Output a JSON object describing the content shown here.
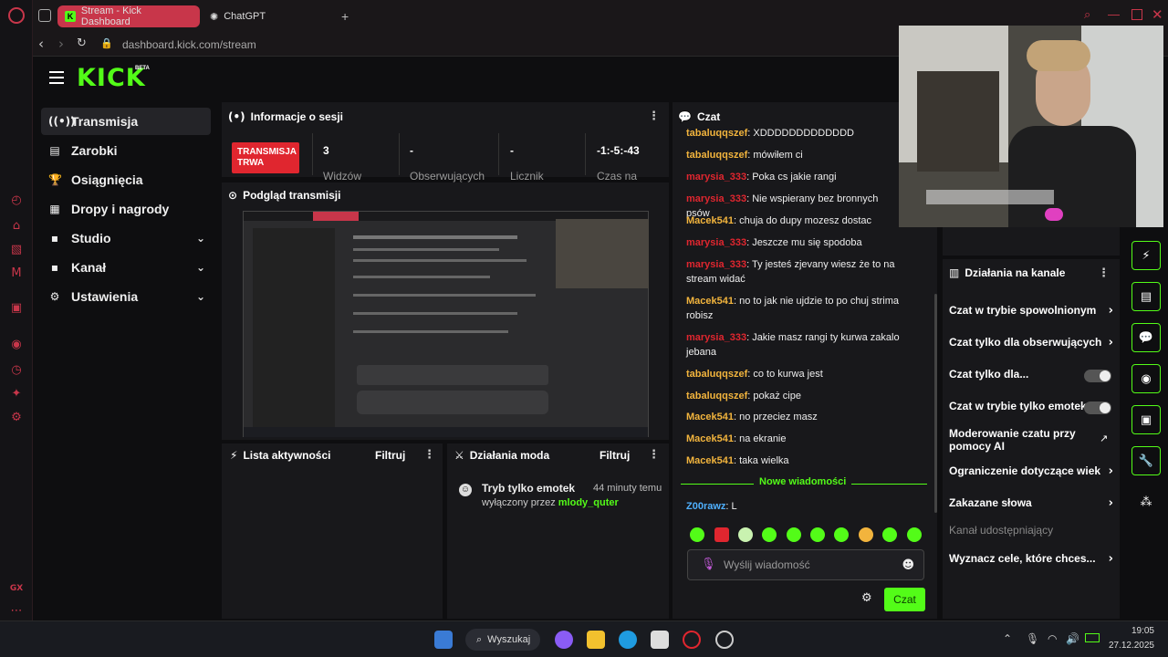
{
  "browser": {
    "tabs": [
      {
        "label": "Stream - Kick Dashboard"
      },
      {
        "label": "ChatGPT"
      }
    ],
    "url": "dashboard.kick.com/stream",
    "gx_label": "GX"
  },
  "logo": {
    "text": "KICK",
    "beta": "BETA"
  },
  "sidebar": {
    "items": [
      {
        "label": "Transmisja"
      },
      {
        "label": "Zarobki"
      },
      {
        "label": "Osiągnięcia"
      },
      {
        "label": "Dropy i nagrody"
      },
      {
        "label": "Studio"
      },
      {
        "label": "Kanał"
      },
      {
        "label": "Ustawienia"
      }
    ]
  },
  "session": {
    "title": "Informacje o sesji",
    "live_badge": "TRANSMISJA TRWA",
    "stats": [
      {
        "value": "3",
        "label": "Widzów"
      },
      {
        "value": "-",
        "label": "Obserwujących"
      },
      {
        "value": "-",
        "label": "Licznik"
      },
      {
        "value": "-1:-5:-43",
        "label": "Czas na"
      }
    ]
  },
  "preview": {
    "title": "Podgląd transmisji"
  },
  "activity": {
    "title": "Lista aktywności",
    "filter": "Filtruj"
  },
  "modactions": {
    "title": "Działania moda",
    "filter": "Filtruj",
    "entry": {
      "title": "Tryb tylko emotek",
      "time": "44 minuty temu",
      "by_prefix": "wyłączony przez",
      "user": "mlody_quter"
    }
  },
  "chat": {
    "title": "Czat",
    "messages": [
      {
        "user": "tabaluqqszef",
        "text": "XDDDDDDDDDDDDD"
      },
      {
        "user": "tabaluqqszef",
        "text": "mówiłem ci"
      },
      {
        "user": "marysia_333",
        "text": "Poka cs jakie rangi"
      },
      {
        "user": "marysia_333",
        "text": "Nie wspierany bez bronnych psów"
      },
      {
        "user": "Macek541",
        "text": "chuja do dupy mozesz dostac"
      },
      {
        "user": "marysia_333",
        "text": "Jeszcze mu się spodoba"
      },
      {
        "user": "marysia_333",
        "text": "Ty jesteś zjevany wiesz że to na stream widać"
      },
      {
        "user": "Macek541",
        "text": "no to jak nie ujdzie to po chuj strima robisz"
      },
      {
        "user": "marysia_333",
        "text": "Jakie masz rangi ty kurwa zakalo jebana"
      },
      {
        "user": "tabaluqqszef",
        "text": "co to kurwa jest"
      },
      {
        "user": "tabaluqqszef",
        "text": "pokaż cipe"
      },
      {
        "user": "Macek541",
        "text": "no przeciez masz"
      },
      {
        "user": "Macek541",
        "text": "na ekranie"
      },
      {
        "user": "Macek541",
        "text": "taka wielka"
      }
    ],
    "new_messages": "Nowe wiadomości",
    "latest": {
      "user": "Z00rawz",
      "text": "L"
    },
    "input_placeholder": "Wyślij wiadomość",
    "send": "Czat"
  },
  "channel_actions": {
    "title": "Działania na kanale",
    "items": [
      {
        "label": "Czat w trybie spowolnionym"
      },
      {
        "label": "Czat tylko dla obserwujących"
      },
      {
        "label": "Czat tylko dla..."
      },
      {
        "label": "Czat w trybie tylko emotek"
      },
      {
        "label": "Moderowanie czatu przy pomocy AI"
      },
      {
        "label": "Ograniczenie dotyczące wiek"
      },
      {
        "label": "Zakazane słowa"
      },
      {
        "label": "Kanał udostępniający"
      },
      {
        "label": "Wyznacz cele, które chces..."
      }
    ]
  },
  "taskbar": {
    "search": "Wyszukaj",
    "time": "19:05",
    "date": "27.12.2025"
  },
  "colors": {
    "accent": "#53fc18",
    "live": "#e0262f",
    "opera": "#c8364a"
  }
}
